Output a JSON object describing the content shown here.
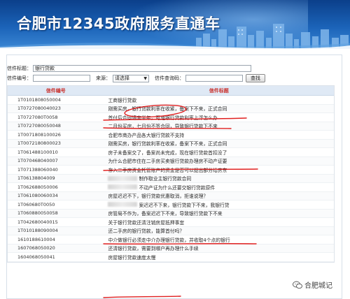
{
  "header": {
    "title": "合肥市12345政府服务直通车"
  },
  "search": {
    "title_label": "信件标题：",
    "title_value": "银行贷款",
    "number_label": "信件编号：",
    "number_value": "",
    "source_label": "来源：",
    "source_value": "请选择",
    "query_code_label": "信件查询码：",
    "query_code_value": "",
    "search_button": "查找"
  },
  "table": {
    "headers": [
      "信件编号",
      "信件标题"
    ],
    "rows": [
      {
        "id": "1T0101808050004",
        "title": "工商银行贷款"
      },
      {
        "id": "1T0727080040023",
        "title": "刚需买房，银行贷款利率在收紧，备案下不来，正式合同"
      },
      {
        "id": "1T0727080T0058",
        "title": "首付后合同遇害半年，可是银行贷款利率上浮怎么办"
      },
      {
        "id": "1T0727080050048",
        "title": "二月份买房，七月份不签合同，导致银行贷款下不来"
      },
      {
        "id": "1T0071808100026",
        "title": "合肥市商办产品各大银行贷款不支持"
      },
      {
        "id": "1T0072180800023",
        "title": "刚需买房，银行贷款利率在收紧，备案下不来，正式合同"
      },
      {
        "id": "1T061488100010",
        "title": "房子未备案交了，备案尚未完成，现在银行贷款首扣没了"
      },
      {
        "id": "1T070468040007",
        "title": "为什么合肥市住在二手房买卖银行贷款办理房不动产证要"
      },
      {
        "id": "1T071388060040",
        "title": "存入二手房资金托管账户的资金是否可以提出部分给房东"
      },
      {
        "id": "1T06138804009",
        "title": "制作取业主银行贷款合同"
      },
      {
        "id": "1T062688050006",
        "title": "不动产证为什么还要交银行贷款原件"
      },
      {
        "id": "1T061080060034",
        "title": "房屋迟迟不下，银行贷款优惠取消，拒谁说理？"
      },
      {
        "id": "1T060680T0050",
        "title": "案迟迟不下来，银行贷款下不来，我银行贷"
      },
      {
        "id": "1T060880050058",
        "title": "房管局不作为，备案迟迟下不来，导致银行贷款下不来"
      },
      {
        "id": "1T042680040015",
        "title": "关于银行贷款还清注销房屋抵押事宜"
      },
      {
        "id": "1T010188090004",
        "title": "还二手房的银行贷款，能算首付吗？"
      },
      {
        "id": "1610188610004",
        "title": "中介做银行必须走中介办理银行贷款，并收取4个点的银行"
      },
      {
        "id": "1607068050020",
        "title": "还清银行贷款，需要到哪户再办理什么手续"
      },
      {
        "id": "1604068050041",
        "title": "房屋银行贷款速度太慢"
      }
    ]
  },
  "watermark": {
    "text": "合肥城记"
  },
  "colors": {
    "header_text": "#c9302c",
    "annotation": "#e02020",
    "banner": "#1b63b8"
  }
}
